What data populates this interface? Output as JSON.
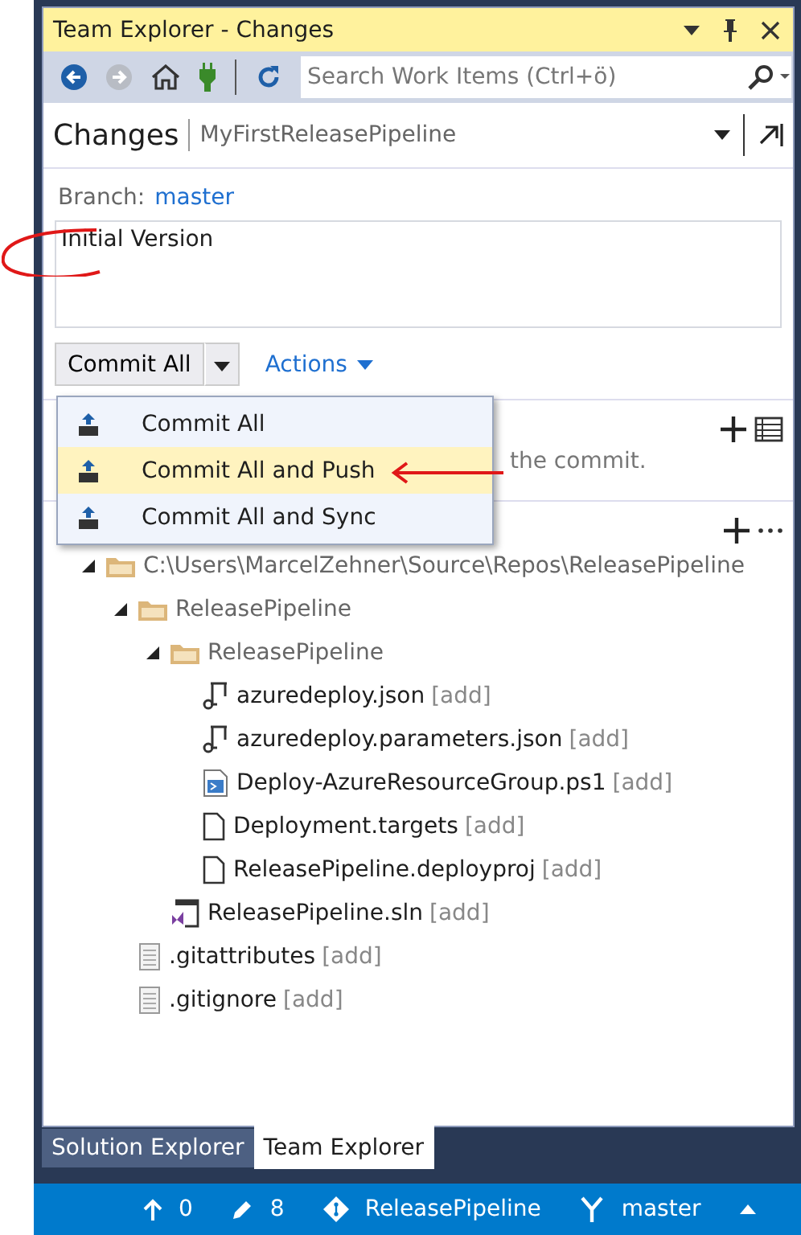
{
  "window": {
    "title": "Team Explorer - Changes"
  },
  "toolbar": {
    "search": {
      "placeholder": "Search Work Items (Ctrl+ö)"
    }
  },
  "header": {
    "title": "Changes",
    "subtitle": "MyFirstReleasePipeline"
  },
  "branch": {
    "label": "Branch:",
    "value": "master"
  },
  "commit_message": {
    "value": "Initial Version"
  },
  "commit_button": {
    "label": "Commit All"
  },
  "actions": {
    "label": "Actions"
  },
  "commit_menu": [
    {
      "label": "Commit All",
      "selected": false
    },
    {
      "label": "Commit All and Push",
      "selected": true
    },
    {
      "label": "Commit All and Sync",
      "selected": false
    }
  ],
  "related_section": {
    "hint": "the commit."
  },
  "changes_tree": [
    {
      "kind": "folder",
      "name": "C:\\Users\\MarcelZehner\\Source\\Repos\\ReleasePipeline",
      "expanded": true,
      "children": [
        {
          "kind": "folder",
          "name": "ReleasePipeline",
          "expanded": true,
          "children": [
            {
              "kind": "folder",
              "name": "ReleasePipeline",
              "expanded": true,
              "children": [
                {
                  "kind": "json",
                  "name": "azuredeploy.json",
                  "status": "[add]"
                },
                {
                  "kind": "json",
                  "name": "azuredeploy.parameters.json",
                  "status": "[add]"
                },
                {
                  "kind": "script",
                  "name": "Deploy-AzureResourceGroup.ps1",
                  "status": "[add]"
                },
                {
                  "kind": "file",
                  "name": "Deployment.targets",
                  "status": "[add]"
                },
                {
                  "kind": "file",
                  "name": "ReleasePipeline.deployproj",
                  "status": "[add]"
                }
              ]
            },
            {
              "kind": "solution",
              "name": "ReleasePipeline.sln",
              "status": "[add]"
            }
          ]
        },
        {
          "kind": "text",
          "name": ".gitattributes",
          "status": "[add]"
        },
        {
          "kind": "text",
          "name": ".gitignore",
          "status": "[add]"
        }
      ]
    }
  ],
  "bottom_tabs": [
    {
      "label": "Solution Explorer",
      "selected": false
    },
    {
      "label": "Team Explorer",
      "selected": true
    }
  ],
  "status_bar": {
    "outgoing": "0",
    "changes": "8",
    "repository": "ReleasePipeline",
    "branch": "master"
  }
}
